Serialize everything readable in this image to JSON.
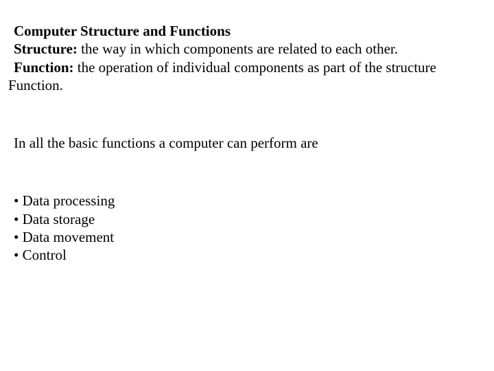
{
  "title": "Computer Structure and Functions",
  "definitions": {
    "structure_label": "Structure:",
    "structure_text": " the way in which components are related to each other.",
    "function_label": "Function:",
    "function_text": " the operation of individual components as part of the structure"
  },
  "function_trailing": "Function.",
  "intro": "In all the basic functions a computer can perform are",
  "bullets": [
    "Data processing",
    "Data storage",
    "Data movement",
    "Control"
  ],
  "bullet_glyph": "•"
}
